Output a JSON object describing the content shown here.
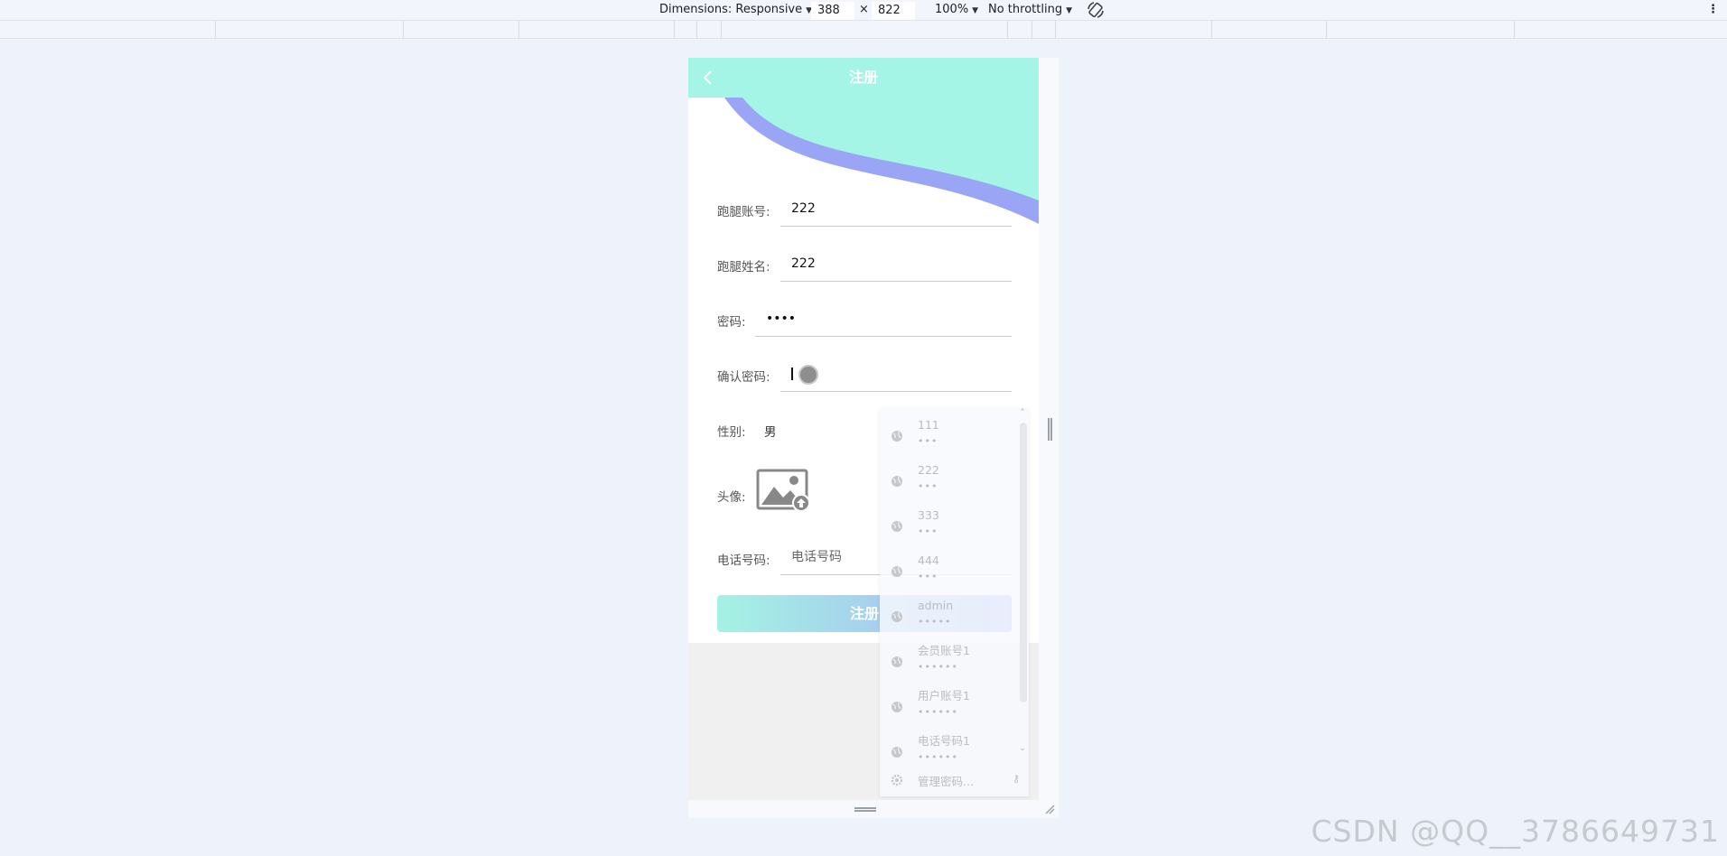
{
  "devtools": {
    "dimensions_label": "Dimensions: Responsive",
    "width": "388",
    "times": "×",
    "height": "822",
    "zoom": "100%",
    "throttling": "No throttling"
  },
  "page": {
    "title": "注册",
    "fields": [
      {
        "label": "跑腿账号:",
        "value": "222"
      },
      {
        "label": "跑腿姓名:",
        "value": "222"
      },
      {
        "label": "密码:",
        "value": "••••"
      },
      {
        "label": "确认密码:",
        "value": ""
      },
      {
        "label": "性别:",
        "value": "男"
      },
      {
        "label": "头像:",
        "value": ""
      },
      {
        "label": "电话号码:",
        "placeholder": "电话号码"
      }
    ],
    "submit_label": "注册"
  },
  "autofill": {
    "items": [
      {
        "user": "111",
        "pwd": "•••"
      },
      {
        "user": "222",
        "pwd": "•••"
      },
      {
        "user": "333",
        "pwd": "•••"
      },
      {
        "user": "444",
        "pwd": "•••"
      },
      {
        "user": "admin",
        "pwd": "•••••"
      },
      {
        "user": "会员账号1",
        "pwd": "••••••"
      },
      {
        "user": "用户账号1",
        "pwd": "••••••"
      },
      {
        "user": "电话号码1",
        "pwd": "••••••"
      }
    ],
    "manage_label": "管理密码..."
  },
  "watermark": "CSDN @QQ__3786649731",
  "colors": {
    "header": "#a4f5e6",
    "wave_purple": "#9aa6f5",
    "button_start": "#a4f2e3",
    "button_end": "#a8b3f7"
  }
}
